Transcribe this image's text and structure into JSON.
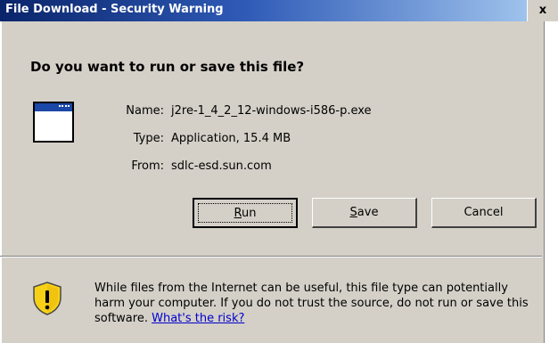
{
  "window": {
    "title": "File Download - Security Warning",
    "close_glyph": "x"
  },
  "question": "Do you want to run or save this file?",
  "file_info": {
    "icon": "application-window-icon",
    "name_label": "Name:",
    "name_value": "j2re-1_4_2_12-windows-i586-p.exe",
    "type_label": "Type:",
    "type_value": "Application, 15.4 MB",
    "from_label": "From:",
    "from_value": "sdlc-esd.sun.com"
  },
  "buttons": {
    "run": {
      "mnemonic": "R",
      "rest": "un"
    },
    "save": {
      "mnemonic": "S",
      "rest": "ave"
    },
    "cancel": "Cancel"
  },
  "warning": {
    "icon": "shield-warning-icon",
    "text": "While files from the Internet can be useful, this file type can potentially harm your computer. If you do not trust the source, do not run or save this software.",
    "link": "What's the risk?"
  },
  "colors": {
    "title_gradient_start": "#0a246a",
    "title_gradient_end": "#a6caf0",
    "dialog_background": "#d4d0c8",
    "link": "#0000cc",
    "shield_yellow": "#f7d117"
  }
}
